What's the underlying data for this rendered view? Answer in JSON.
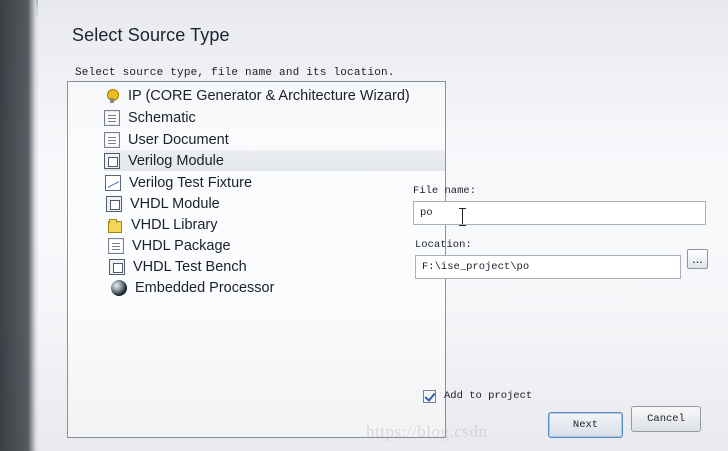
{
  "dialog": {
    "title": "Select Source Type",
    "instruction": "Select source type, file name and its location."
  },
  "source_types": [
    {
      "label": "IP (CORE Generator & Architecture Wizard)",
      "icon": "bulb-icon"
    },
    {
      "label": "Schematic",
      "icon": "schematic-icon"
    },
    {
      "label": "User Document",
      "icon": "document-icon"
    },
    {
      "label": "Verilog Module",
      "icon": "verilog-module-icon",
      "selected": true
    },
    {
      "label": "Verilog Test Fixture",
      "icon": "test-fixture-icon"
    },
    {
      "label": "VHDL Module",
      "icon": "vhdl-module-icon"
    },
    {
      "label": "VHDL Library",
      "icon": "library-icon"
    },
    {
      "label": "VHDL Package",
      "icon": "package-icon"
    },
    {
      "label": "VHDL Test Bench",
      "icon": "test-bench-icon"
    },
    {
      "label": "Embedded Processor",
      "icon": "processor-icon"
    }
  ],
  "fields": {
    "file_name_label": "File name:",
    "file_name_value": "po",
    "location_label": "Location:",
    "location_value": "F:\\ise_project\\po",
    "browse_label": "..."
  },
  "options": {
    "add_to_project": "Add to project",
    "add_to_project_checked": true
  },
  "buttons": {
    "next": "Next",
    "cancel": "Cancel"
  },
  "watermark": "https://blog.csdn",
  "colors": {
    "dialog_background": "#f6f7fb",
    "selected_row": "#e6e8ec",
    "primary_button_border": "#5b8ec9"
  }
}
